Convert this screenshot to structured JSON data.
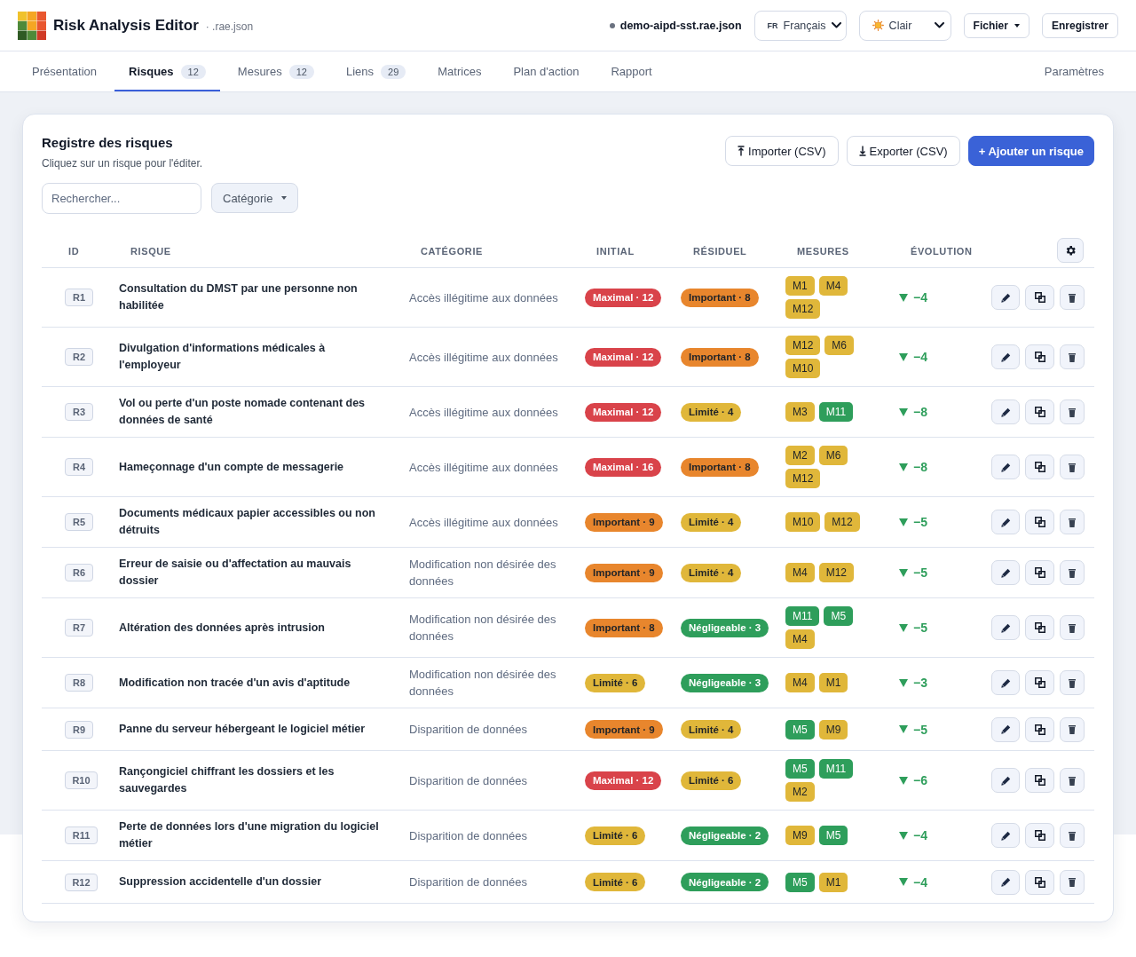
{
  "header": {
    "title": "Risk Analysis Editor",
    "subtitle": "· .rae.json",
    "file_name": "demo-aipd-sst.rae.json",
    "language": {
      "flag": "FR",
      "value": "Français"
    },
    "theme": {
      "value": "Clair"
    },
    "file_menu": "Fichier",
    "save_button": "Enregistrer"
  },
  "tabs": [
    {
      "label": "Présentation",
      "selected": false
    },
    {
      "label": "Risques",
      "count": "12",
      "selected": true
    },
    {
      "label": "Mesures",
      "count": "12",
      "selected": false
    },
    {
      "label": "Liens",
      "count": "29",
      "selected": false
    },
    {
      "label": "Matrices",
      "selected": false
    },
    {
      "label": "Plan d'action",
      "selected": false
    },
    {
      "label": "Rapport",
      "selected": false
    }
  ],
  "settings_tab": {
    "label": "Paramètres",
    "selected": false
  },
  "register": {
    "title": "Registre des risques",
    "subtitle": "Cliquez sur un risque pour l'éditer.",
    "buttons": [
      {
        "label": "Importer (CSV)",
        "kind": "import"
      },
      {
        "label": "Exporter (CSV)",
        "kind": "export"
      },
      {
        "label": "+ Ajouter un risque",
        "kind": "primary"
      }
    ],
    "search": {
      "placeholder": "Rechercher..."
    },
    "category_filter": "Catégorie",
    "columns": [
      "ID",
      "RISQUE",
      "CATÉGORIE",
      "INITIAL",
      "RÉSIDUEL",
      "MESURES",
      "ÉVOLUTION"
    ],
    "risks": [
      {
        "id": "R1",
        "title": "Consultation du DMST par une personne non habilitée",
        "category": "Accès illégitime aux données",
        "initial": {
          "label": "Maximal · 12",
          "color": "#d9434a"
        },
        "residual": {
          "label": "Important · 8",
          "color": "#e8862d"
        },
        "measures": [
          {
            "label": "M1",
            "color": "#e0b73a"
          },
          {
            "label": "M4",
            "color": "#e0b73a"
          },
          {
            "label": "M12",
            "color": "#e0b73a"
          }
        ],
        "evolution": "−4"
      },
      {
        "id": "R2",
        "title": "Divulgation d'informations médicales à l'employeur",
        "category": "Accès illégitime aux données",
        "initial": {
          "label": "Maximal · 12",
          "color": "#d9434a"
        },
        "residual": {
          "label": "Important · 8",
          "color": "#e8862d"
        },
        "measures": [
          {
            "label": "M12",
            "color": "#e0b73a"
          },
          {
            "label": "M6",
            "color": "#e0b73a"
          },
          {
            "label": "M10",
            "color": "#e0b73a"
          }
        ],
        "evolution": "−4"
      },
      {
        "id": "R3",
        "title": "Vol ou perte d'un poste nomade contenant des données de santé",
        "category": "Accès illégitime aux données",
        "initial": {
          "label": "Maximal · 12",
          "color": "#d9434a"
        },
        "residual": {
          "label": "Limité · 4",
          "color": "#e0b73a"
        },
        "measures": [
          {
            "label": "M3",
            "color": "#e0b73a"
          },
          {
            "label": "M11",
            "color": "#2e9e5b"
          }
        ],
        "evolution": "−8"
      },
      {
        "id": "R4",
        "title": "Hameçonnage d'un compte de messagerie",
        "category": "Accès illégitime aux données",
        "initial": {
          "label": "Maximal · 16",
          "color": "#d9434a"
        },
        "residual": {
          "label": "Important · 8",
          "color": "#e8862d"
        },
        "measures": [
          {
            "label": "M2",
            "color": "#e0b73a"
          },
          {
            "label": "M6",
            "color": "#e0b73a"
          },
          {
            "label": "M12",
            "color": "#e0b73a"
          }
        ],
        "evolution": "−8"
      },
      {
        "id": "R5",
        "title": "Documents médicaux papier accessibles ou non détruits",
        "category": "Accès illégitime aux données",
        "initial": {
          "label": "Important · 9",
          "color": "#e8862d"
        },
        "residual": {
          "label": "Limité · 4",
          "color": "#e0b73a"
        },
        "measures": [
          {
            "label": "M10",
            "color": "#e0b73a"
          },
          {
            "label": "M12",
            "color": "#e0b73a"
          }
        ],
        "evolution": "−5"
      },
      {
        "id": "R6",
        "title": "Erreur de saisie ou d'affectation au mauvais dossier",
        "category": "Modification non désirée des données",
        "initial": {
          "label": "Important · 9",
          "color": "#e8862d"
        },
        "residual": {
          "label": "Limité · 4",
          "color": "#e0b73a"
        },
        "measures": [
          {
            "label": "M4",
            "color": "#e0b73a"
          },
          {
            "label": "M12",
            "color": "#e0b73a"
          }
        ],
        "evolution": "−5"
      },
      {
        "id": "R7",
        "title": "Altération des données après intrusion",
        "category": "Modification non désirée des données",
        "initial": {
          "label": "Important · 8",
          "color": "#e8862d"
        },
        "residual": {
          "label": "Négligeable · 3",
          "color": "#2e9e5b"
        },
        "measures": [
          {
            "label": "M11",
            "color": "#2e9e5b"
          },
          {
            "label": "M5",
            "color": "#2e9e5b"
          },
          {
            "label": "M4",
            "color": "#e0b73a"
          }
        ],
        "evolution": "−5"
      },
      {
        "id": "R8",
        "title": "Modification non tracée d'un avis d'aptitude",
        "category": "Modification non désirée des données",
        "initial": {
          "label": "Limité · 6",
          "color": "#e0b73a"
        },
        "residual": {
          "label": "Négligeable · 3",
          "color": "#2e9e5b"
        },
        "measures": [
          {
            "label": "M4",
            "color": "#e0b73a"
          },
          {
            "label": "M1",
            "color": "#e0b73a"
          }
        ],
        "evolution": "−3"
      },
      {
        "id": "R9",
        "title": "Panne du serveur hébergeant le logiciel métier",
        "category": "Disparition de données",
        "initial": {
          "label": "Important · 9",
          "color": "#e8862d"
        },
        "residual": {
          "label": "Limité · 4",
          "color": "#e0b73a"
        },
        "measures": [
          {
            "label": "M5",
            "color": "#2e9e5b"
          },
          {
            "label": "M9",
            "color": "#e0b73a"
          }
        ],
        "evolution": "−5"
      },
      {
        "id": "R10",
        "title": "Rançongiciel chiffrant les dossiers et les sauvegardes",
        "category": "Disparition de données",
        "initial": {
          "label": "Maximal · 12",
          "color": "#d9434a"
        },
        "residual": {
          "label": "Limité · 6",
          "color": "#e0b73a"
        },
        "measures": [
          {
            "label": "M5",
            "color": "#2e9e5b"
          },
          {
            "label": "M11",
            "color": "#2e9e5b"
          },
          {
            "label": "M2",
            "color": "#e0b73a"
          }
        ],
        "evolution": "−6"
      },
      {
        "id": "R11",
        "title": "Perte de données lors d'une migration du logiciel métier",
        "category": "Disparition de données",
        "initial": {
          "label": "Limité · 6",
          "color": "#e0b73a"
        },
        "residual": {
          "label": "Négligeable · 2",
          "color": "#2e9e5b"
        },
        "measures": [
          {
            "label": "M9",
            "color": "#e0b73a"
          },
          {
            "label": "M5",
            "color": "#2e9e5b"
          }
        ],
        "evolution": "−4"
      },
      {
        "id": "R12",
        "title": "Suppression accidentelle d'un dossier",
        "category": "Disparition de données",
        "initial": {
          "label": "Limité · 6",
          "color": "#e0b73a"
        },
        "residual": {
          "label": "Négligeable · 2",
          "color": "#2e9e5b"
        },
        "measures": [
          {
            "label": "M5",
            "color": "#2e9e5b"
          },
          {
            "label": "M1",
            "color": "#e0b73a"
          }
        ],
        "evolution": "−4"
      }
    ]
  }
}
